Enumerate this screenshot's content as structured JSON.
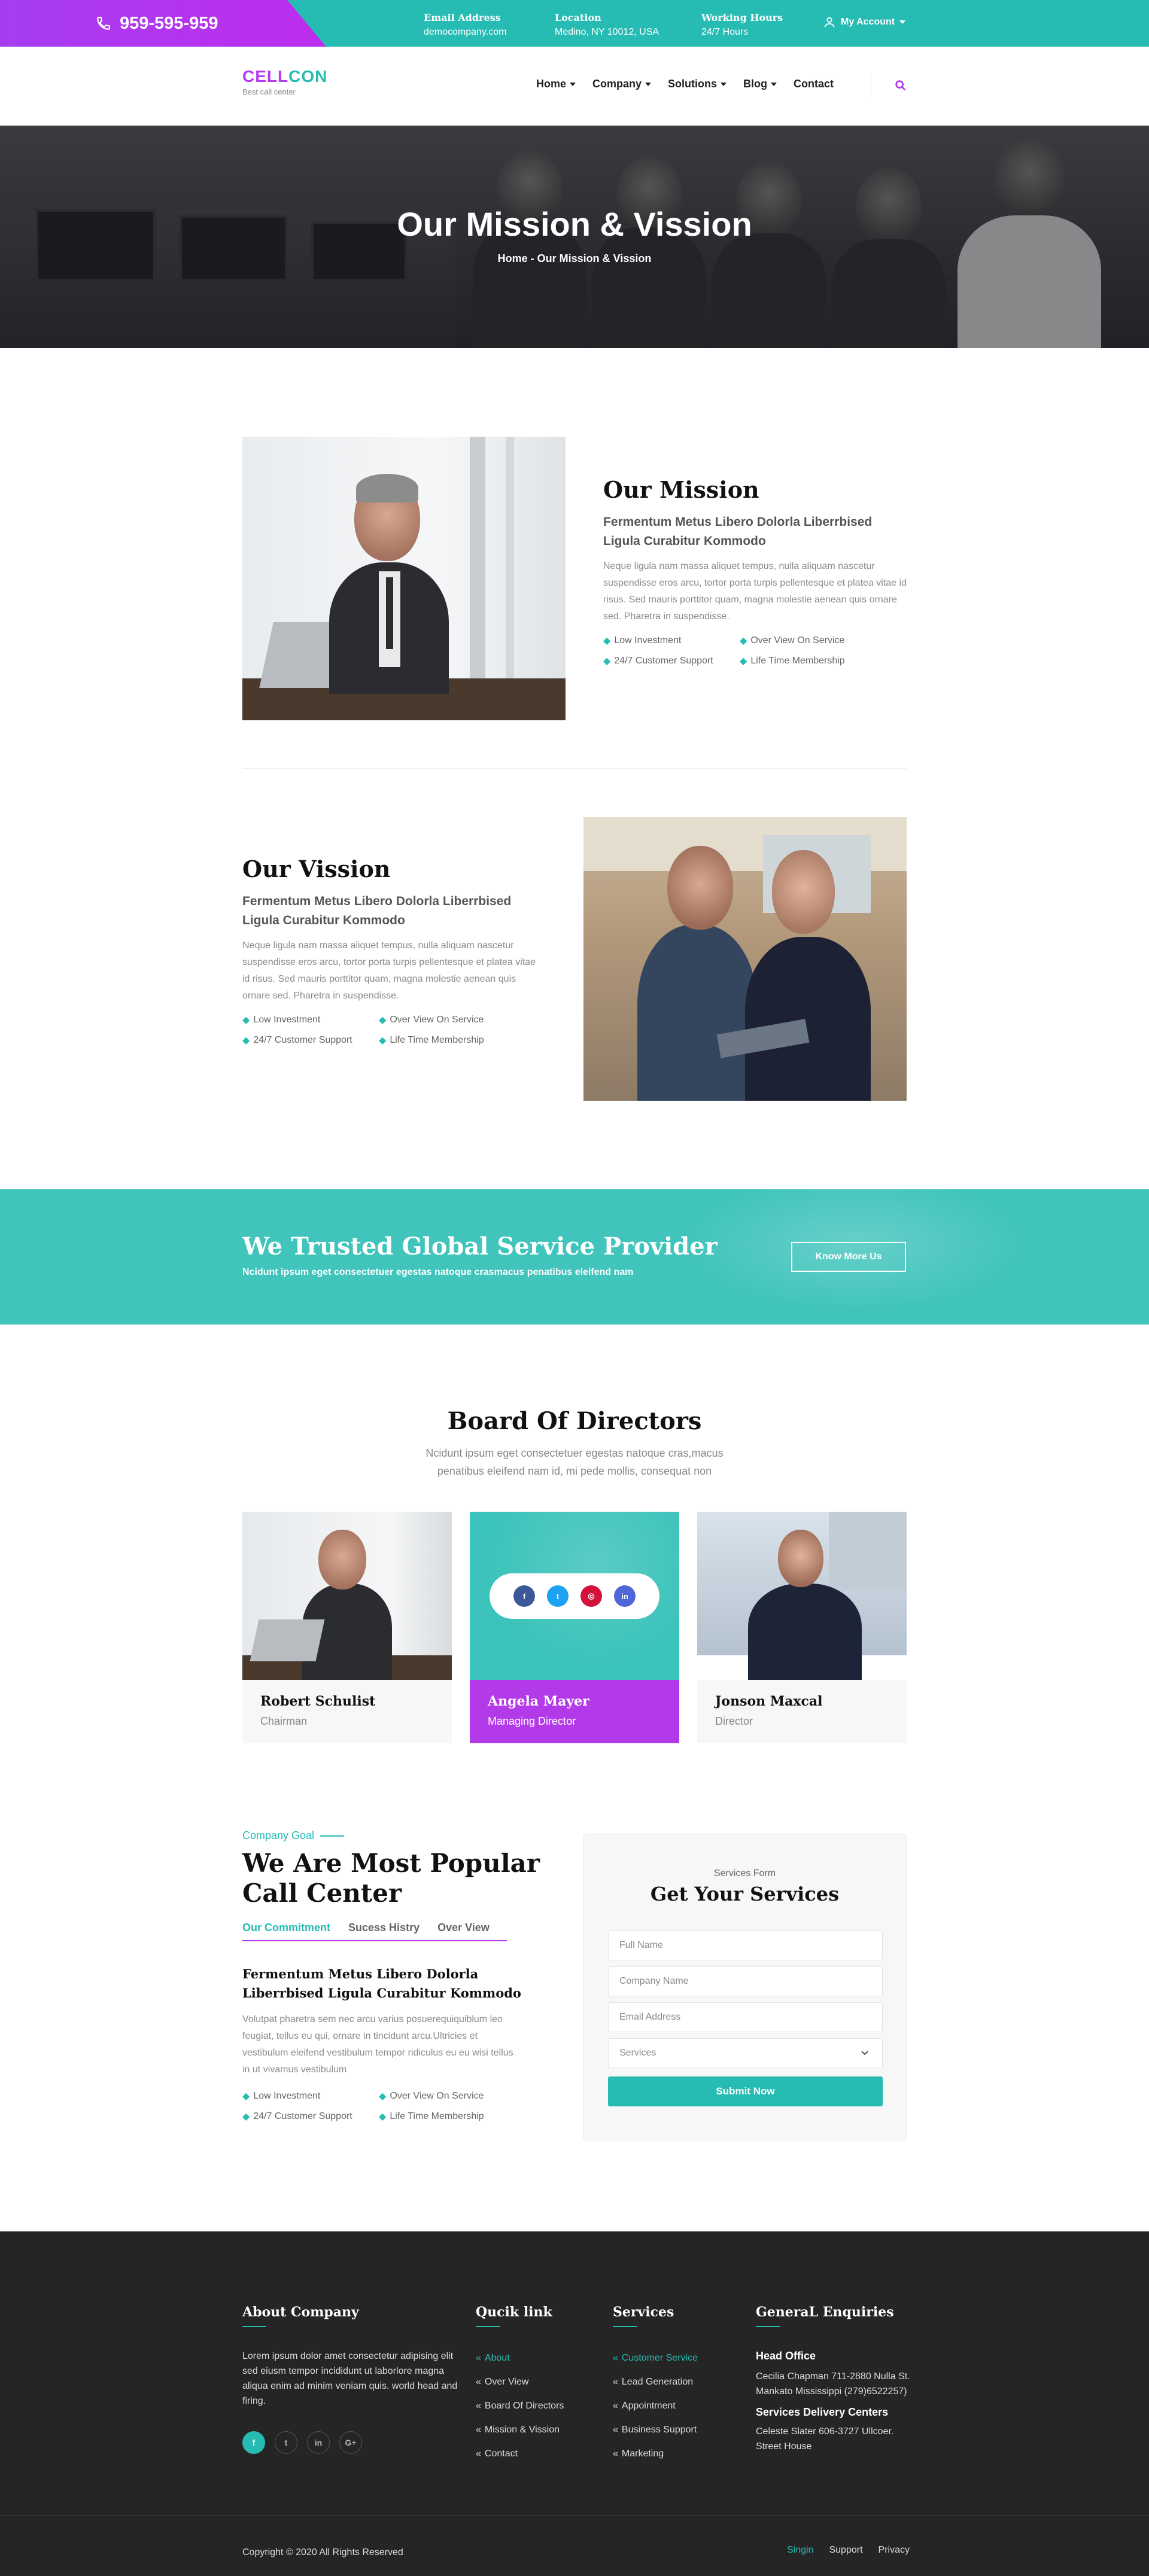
{
  "topbar": {
    "phone": "959-595-959",
    "email_label": "Email Address",
    "email_value": "democompany.com",
    "location_label": "Location",
    "location_value": "Medino, NY 10012, USA",
    "hours_label": "Working Hours",
    "hours_value": "24/7 Hours",
    "account_label": "My Account"
  },
  "nav": {
    "logo_main": "CELL",
    "logo_accent": "CON",
    "logo_tagline": "Best call center",
    "items": [
      "Home",
      "Company",
      "Solutions",
      "Blog",
      "Contact"
    ]
  },
  "hero": {
    "title": "Our Mission & Vission",
    "crumb_home": "Home",
    "crumb_sep": " - ",
    "crumb_current": "Our Mission & Vission"
  },
  "mission": {
    "title": "Our Mission",
    "subtitle": "Fermentum Metus Libero Dolorla  Liberrbised Ligula Curabitur Kommodo",
    "text": "Neque ligula nam massa aliquet tempus, nulla aliquam nascetur suspendisse eros arcu, tortor porta turpis pellentesque et platea vitae id risus. Sed mauris porttitor quam, magna molestie aenean quis ornare sed. Pharetra in suspendisse.",
    "features": [
      "Low Investment",
      "Over View On Service",
      "24/7 Customer Support",
      "Life Time Membership"
    ]
  },
  "vission": {
    "title": "Our Vission",
    "subtitle": "Fermentum Metus Libero Dolorla  Liberrbised Ligula Curabitur Kommodo",
    "text": "Neque ligula nam massa aliquet tempus, nulla aliquam nascetur suspendisse eros arcu, tortor porta turpis pellentesque et platea vitae id risus. Sed mauris porttitor quam, magna molestie aenean quis ornare sed. Pharetra in suspendisse.",
    "features": [
      "Low Investment",
      "Over View On Service",
      "24/7 Customer Support",
      "Life Time Membership"
    ]
  },
  "banner": {
    "title": "We Trusted Global Service Provider",
    "text": "Ncidunt ipsum eget consectetuer egestas natoque crasmacus penatibus eleifend nam",
    "button": "Know More Us"
  },
  "board": {
    "title": "Board Of Directors",
    "subtitle_1": "Ncidunt ipsum eget consectetuer egestas natoque cras,macus",
    "subtitle_2": "penatibus eleifend nam id, mi pede mollis, consequat non",
    "members": [
      {
        "name": "Robert Schulist",
        "role": "Chairman"
      },
      {
        "name": "Angela Mayer",
        "role": "Managing Director"
      },
      {
        "name": "Jonson Maxcal",
        "role": "Director"
      }
    ],
    "social_labels": [
      "f",
      "t",
      "◎",
      "in"
    ]
  },
  "goal": {
    "tag": "Company Goal",
    "title_1": "We Are Most Popular",
    "title_2": "Call Center",
    "tabs": [
      "Our Commitment",
      "Sucess Histry",
      "Over View"
    ],
    "subtitle": "Fermentum Metus Libero Dolorla  Liberrbised Ligula Curabitur Kommodo",
    "text": "Volutpat pharetra sem nec arcu varius posuerequiquiblum leo feugiat, tellus eu qui, ornare in tincidunt arcu.Ultricies et vestibulum eleifend vestibulum tempor ridiculus eu eu wisi tellus in ut vivamus vestibulum",
    "features": [
      "Low Investment",
      "Over View On Service",
      "24/7 Customer Support",
      "Life Time Membership"
    ]
  },
  "form": {
    "label": "Services Form",
    "title": "Get Your Services",
    "fullname_placeholder": "Full Name",
    "company_placeholder": "Company Name",
    "email_placeholder": "Email Address",
    "services_selected": "Services",
    "submit": "Submit Now"
  },
  "footer": {
    "about_title": "About Company",
    "about_text": "Lorem ipsum dolor amet consectetur adipising elit sed eiusm tempor incididunt ut laborlore magna aliqua enim ad minim veniam quis. world head and firing.",
    "social_labels": [
      "f",
      "t",
      "in",
      "G+"
    ],
    "quick_title": "Qucik link",
    "quick_links": [
      "About",
      "Over View",
      "Board Of Directors",
      "Mission & Vission",
      "Contact"
    ],
    "services_title": "Services",
    "services_links": [
      "Customer Service",
      "Lead Generation",
      "Appointment",
      "Business Support",
      "Marketing"
    ],
    "enq_title": "GeneraL Enquiries",
    "head_office_title": "Head Office",
    "head_office_text": "Cecilia Chapman 711-2880 Nulla St. Mankato Mississippi (279)6522257)",
    "delivery_title": "Services Delivery Centers",
    "delivery_text": "Celeste Slater 606-3727 Ullcoer. Street House",
    "copyright": "Copyright © 2020 All Rights Reserved",
    "bottom_links": [
      "Singin",
      "Support",
      "Privacy"
    ]
  },
  "colors": {
    "teal": "#27bcb3",
    "purple": "#b33ae8",
    "footer": "#252525"
  }
}
